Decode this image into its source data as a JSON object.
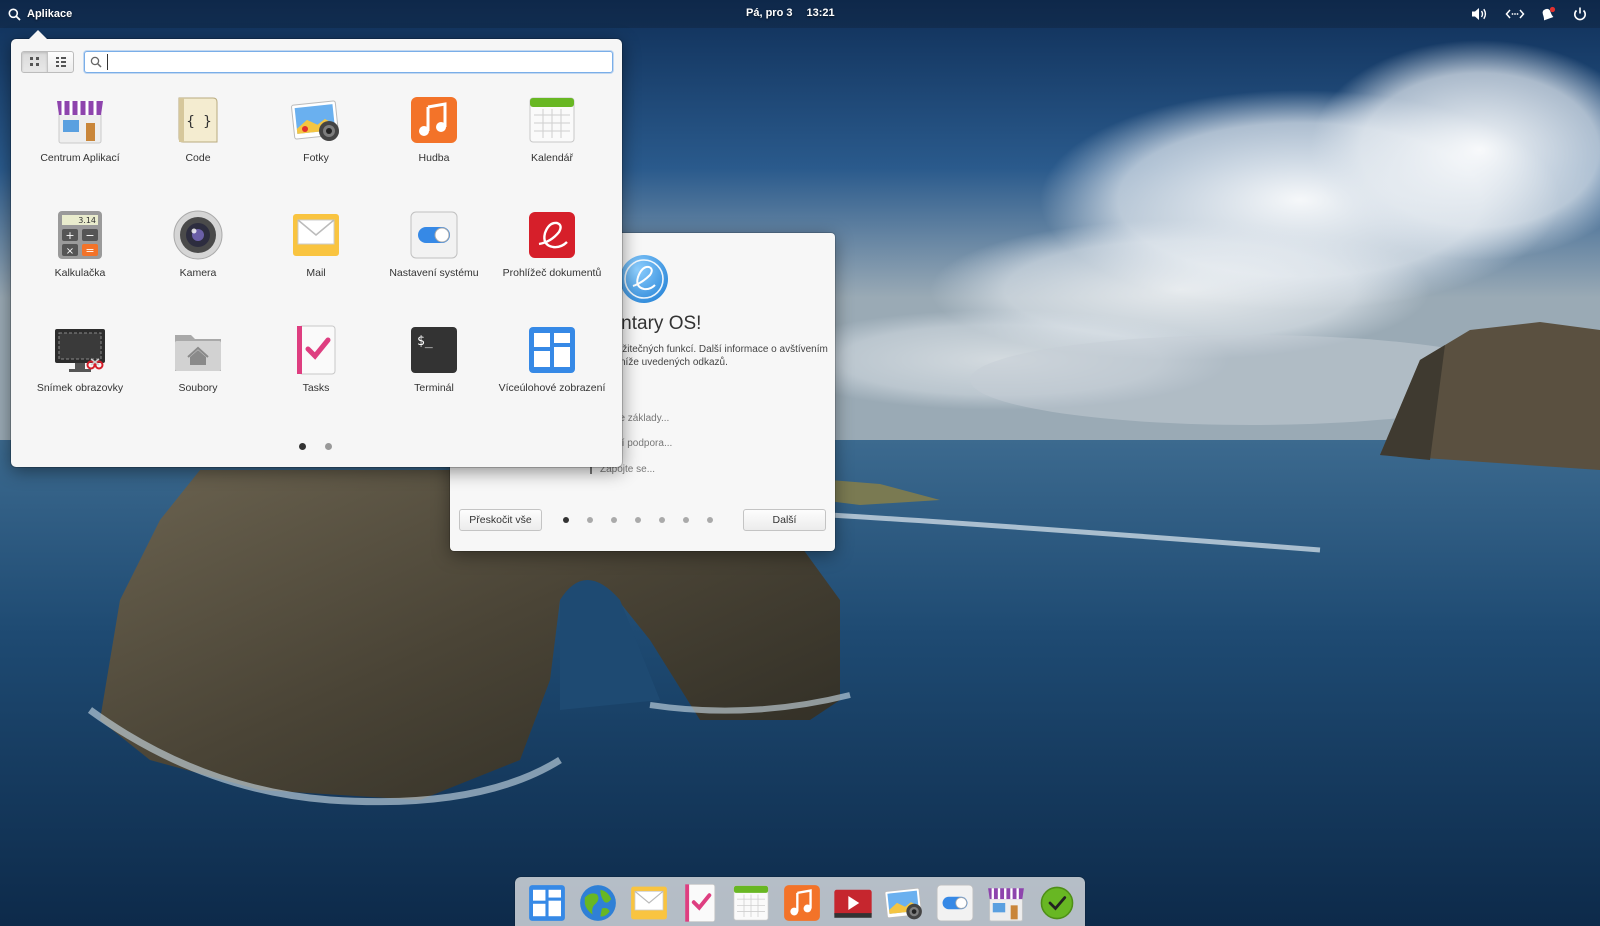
{
  "panel": {
    "applications_label": "Aplikace",
    "date": "Pá, pro 3",
    "time": "13:21",
    "indicators": [
      "volume-icon",
      "network-icon",
      "notifications-icon",
      "power-icon"
    ]
  },
  "launcher": {
    "search": {
      "value": "",
      "placeholder": ""
    },
    "view_modes": [
      "grid-view-icon",
      "category-view-icon"
    ],
    "apps": [
      {
        "label": "Centrum Aplikací",
        "icon": "appcenter-icon"
      },
      {
        "label": "Code",
        "icon": "code-icon"
      },
      {
        "label": "Fotky",
        "icon": "photos-icon"
      },
      {
        "label": "Hudba",
        "icon": "music-icon"
      },
      {
        "label": "Kalendář",
        "icon": "calendar-icon"
      },
      {
        "label": "Kalkulačka",
        "icon": "calculator-icon"
      },
      {
        "label": "Kamera",
        "icon": "camera-icon"
      },
      {
        "label": "Mail",
        "icon": "mail-icon"
      },
      {
        "label": "Nastavení systému",
        "icon": "settings-icon"
      },
      {
        "label": "Prohlížeč dokumentů",
        "icon": "document-viewer-icon"
      },
      {
        "label": "Snímek obrazovky",
        "icon": "screenshot-icon"
      },
      {
        "label": "Soubory",
        "icon": "files-icon"
      },
      {
        "label": "Tasks",
        "icon": "tasks-icon"
      },
      {
        "label": "Terminál",
        "icon": "terminal-icon"
      },
      {
        "label": "Víceúlohové zobrazení",
        "icon": "multitasking-view-icon"
      }
    ],
    "page_count": 2,
    "current_page": 1
  },
  "welcome": {
    "title": "lementary OS!",
    "description": "ιžitečných funkcí. Další informace o avštívením níže uvedených odkazů.",
    "links": [
      "rodce základy...",
      "unitní podpora...",
      "Zapojte se..."
    ],
    "skip_label": "Přeskočit vše",
    "next_label": "Další",
    "page_count": 7,
    "current_page": 1
  },
  "dock": {
    "items": [
      "multitasking-view-icon",
      "web-browser-icon",
      "mail-icon",
      "tasks-icon",
      "calendar-icon",
      "music-icon",
      "videos-icon",
      "photos-icon",
      "settings-icon",
      "appcenter-icon",
      "updates-icon"
    ]
  },
  "colors": {
    "accent_blue": "#3689e6",
    "panel_text": "#ffffff",
    "launcher_bg": "#f6f6f6"
  }
}
